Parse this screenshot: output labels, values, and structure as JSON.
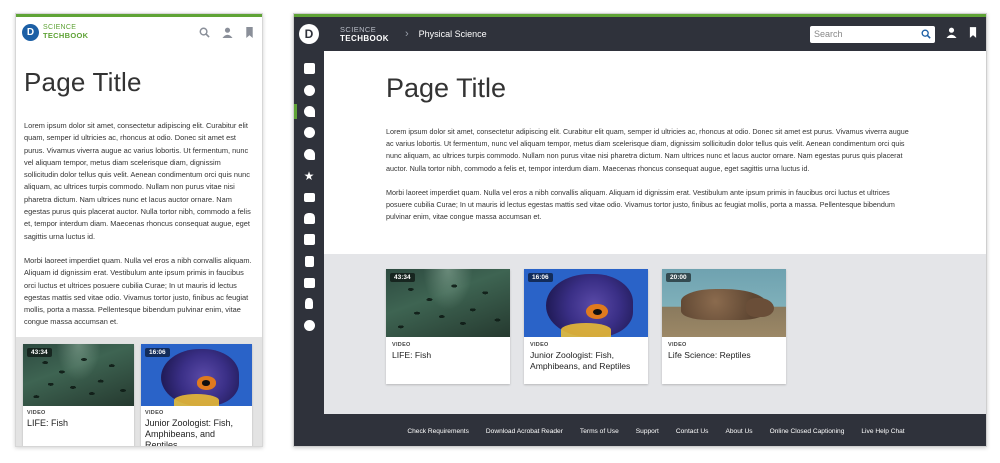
{
  "mobile": {
    "logo": {
      "line1": "SCIENCE",
      "line2": "TECHBOOK",
      "mark": "D"
    },
    "header_icons": [
      "search-icon",
      "user-icon",
      "bookmark-icon"
    ],
    "page_title": "Page Title",
    "paragraph1": "Lorem ipsum dolor sit amet, consectetur adipiscing elit. Curabitur elit quam, semper id ultricies ac, rhoncus at odio. Donec sit amet est purus. Vivamus viverra augue ac varius lobortis. Ut fermentum, nunc vel aliquam tempor, metus diam scelerisque diam, dignissim sollicitudin dolor tellus quis velit. Aenean condimentum orci quis nunc aliquam, ac ultrices turpis commodo. Nullam non purus vitae nisi pharetra dictum. Nam ultrices nunc et lacus auctor ornare. Nam egestas purus quis placerat auctor. Nulla tortor nibh, commodo a felis et, tempor interdum diam. Maecenas rhoncus consequat augue, eget sagittis urna luctus id.",
    "paragraph2": "Morbi laoreet imperdiet quam. Nulla vel eros a nibh convallis aliquam. Aliquam id dignissim erat. Vestibulum ante ipsum primis in faucibus orci luctus et ultrices posuere cubilia Curae; In ut mauris id lectus egestas mattis sed vitae odio. Vivamus tortor justo, finibus ac feugiat mollis, porta a massa. Pellentesque bibendum pulvinar enim, vitae congue massa accumsan et.",
    "cards": [
      {
        "duration": "43:34",
        "kind": "VIDEO",
        "title": "LIFE: Fish"
      },
      {
        "duration": "16:06",
        "kind": "VIDEO",
        "title": "Junior Zoologist: Fish, Amphibeans, and Reptiles"
      }
    ]
  },
  "desktop": {
    "logo_mark": "D",
    "brand": {
      "line1": "SCIENCE",
      "line2": "TECHBOOK"
    },
    "breadcrumb": "Physical Science",
    "search": {
      "placeholder": "Search",
      "value": ""
    },
    "header_icons": [
      "search-icon",
      "user-icon",
      "bookmark-icon"
    ],
    "sidebar_icons": [
      "calendar-icon",
      "atom-icon",
      "magnet-icon",
      "globe-icon",
      "gauge-icon",
      "star-icon",
      "folder-icon",
      "people-icon",
      "pencil-icon",
      "tools-icon",
      "clapper-icon",
      "presenter-icon",
      "team-icon"
    ],
    "active_sidebar_index": 2,
    "page_title": "Page Title",
    "paragraph1": "Lorem ipsum dolor sit amet, consectetur adipiscing elit. Curabitur elit quam, semper id ultricies ac, rhoncus at odio. Donec sit amet est purus. Vivamus viverra augue ac varius lobortis. Ut fermentum, nunc vel aliquam tempor, metus diam scelerisque diam, dignissim sollicitudin dolor tellus quis velit. Aenean condimentum orci quis nunc aliquam, ac ultrices turpis commodo. Nullam non purus vitae nisi pharetra dictum. Nam ultrices nunc et lacus auctor ornare. Nam egestas purus quis placerat auctor. Nulla tortor nibh, commodo a felis et, tempor interdum diam. Maecenas rhoncus consequat augue, eget sagittis urna luctus id.",
    "paragraph2": "Morbi laoreet imperdiet quam. Nulla vel eros a nibh convallis aliquam. Aliquam id dignissim erat. Vestibulum ante ipsum primis in faucibus orci luctus et ultrices posuere cubilia Curae; In ut mauris id lectus egestas mattis sed vitae odio. Vivamus tortor justo, finibus ac feugiat mollis, porta a massa. Pellentesque bibendum pulvinar enim, vitae congue massa accumsan et.",
    "cards": [
      {
        "duration": "43:34",
        "kind": "VIDEO",
        "title": "LIFE: Fish"
      },
      {
        "duration": "16:06",
        "kind": "VIDEO",
        "title": "Junior Zoologist: Fish, Amphibeans, and Reptiles"
      },
      {
        "duration": "20:00",
        "kind": "VIDEO",
        "title": "Life Science: Reptiles"
      }
    ],
    "footer_links": [
      "Check Requirements",
      "Download Acrobat Reader",
      "Terms of Use",
      "Support",
      "Contact Us",
      "About Us",
      "Online Closed Captioning",
      "Live Help Chat"
    ]
  },
  "colors": {
    "accent_green": "#5fa336",
    "chrome_dark": "#2f323b",
    "band_gray": "#e4e5e8",
    "logo_blue": "#1c5fa5"
  }
}
